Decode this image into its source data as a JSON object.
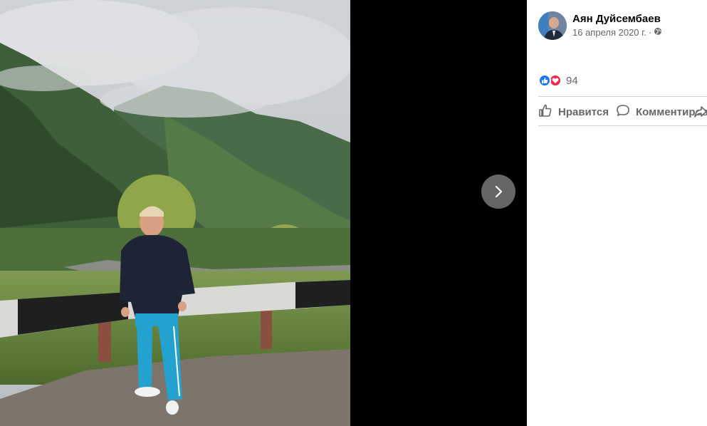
{
  "post": {
    "author": "Аян Дуйсембаев",
    "date": "16 апреля 2020 г.",
    "separator": "·",
    "audience_icon": "globe-icon"
  },
  "reactions": {
    "icons": [
      "like-reaction-icon",
      "love-reaction-icon"
    ],
    "count": "94"
  },
  "actions": {
    "like_label": "Нравится",
    "comment_label": "Комментировать"
  },
  "viewer": {
    "next_icon": "chevron-right-icon"
  },
  "colors": {
    "like_blue": "#1877f2",
    "love_red": "#f0284a",
    "secondary_text": "#65676b",
    "viewer_bg": "#000000"
  }
}
